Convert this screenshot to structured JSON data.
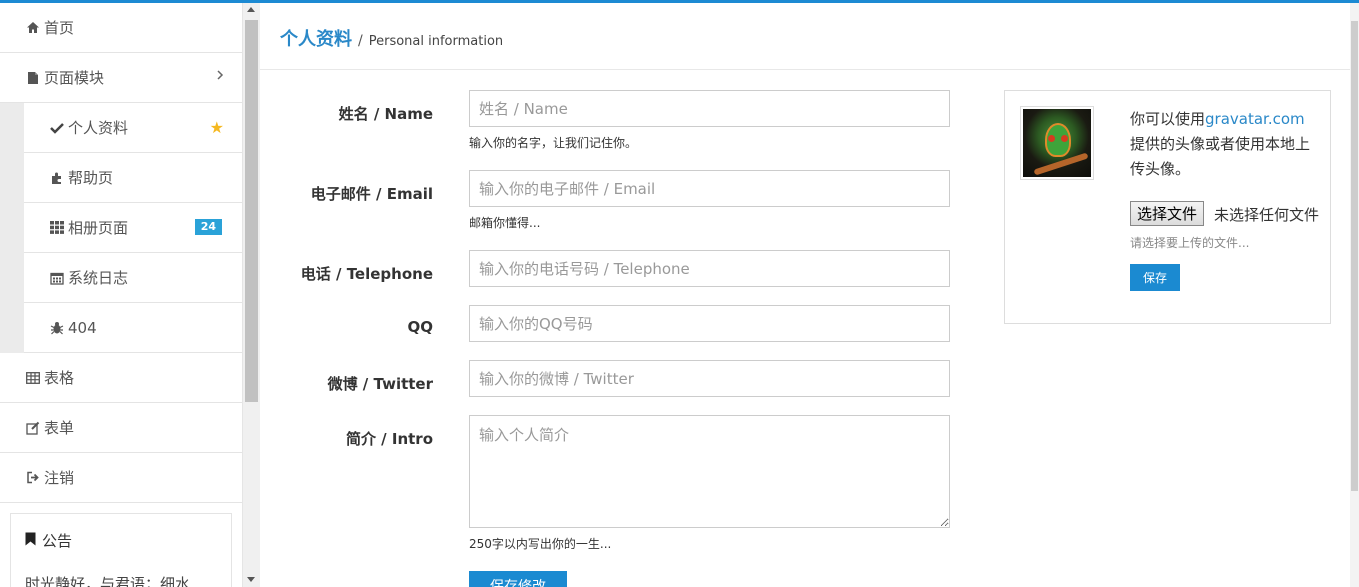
{
  "sidebar": {
    "items": [
      {
        "label": "首页",
        "icon": "home-icon"
      },
      {
        "label": "页面模块",
        "icon": "file-icon"
      },
      {
        "label": "表格",
        "icon": "table-icon"
      },
      {
        "label": "表单",
        "icon": "edit-icon"
      },
      {
        "label": "注销",
        "icon": "sign-out-icon"
      }
    ],
    "subitems": [
      {
        "label": "个人资料",
        "icon": "check-icon"
      },
      {
        "label": "帮助页",
        "icon": "puzzle-icon"
      },
      {
        "label": "相册页面",
        "icon": "grid-icon",
        "badge": "24"
      },
      {
        "label": "系统日志",
        "icon": "calendar-icon"
      },
      {
        "label": "404",
        "icon": "bug-icon"
      }
    ],
    "notice": {
      "title": "公告",
      "text": "时光静好，与君语；细水"
    }
  },
  "header": {
    "title": "个人资料",
    "separator": "/",
    "subtitle": "Personal information"
  },
  "form": {
    "name": {
      "label": "姓名 / Name",
      "placeholder": "姓名 / Name",
      "help": "输入你的名字，让我们记住你。"
    },
    "email": {
      "label": "电子邮件 / Email",
      "placeholder": "输入你的电子邮件 / Email",
      "help": "邮箱你懂得..."
    },
    "phone": {
      "label": "电话 / Telephone",
      "placeholder": "输入你的电话号码 / Telephone"
    },
    "qq": {
      "label": "QQ",
      "placeholder": "输入你的QQ号码"
    },
    "weibo": {
      "label": "微博 / Twitter",
      "placeholder": "输入你的微博 / Twitter"
    },
    "intro": {
      "label": "简介 / Intro",
      "placeholder": "输入个人简介",
      "help": "250字以内写出你的一生..."
    },
    "submit_label": "保存修改"
  },
  "avatar_panel": {
    "text_before": "你可以使用",
    "link": "gravatar.com",
    "text_after": "提供的头像或者使用本地上传头像。",
    "file_button": "选择文件",
    "file_status": "未选择任何文件",
    "help": "请选择要上传的文件...",
    "save_label": "保存"
  },
  "colors": {
    "accent": "#1b8ad1",
    "star": "#f5b820",
    "badge": "#2aa2d8"
  }
}
